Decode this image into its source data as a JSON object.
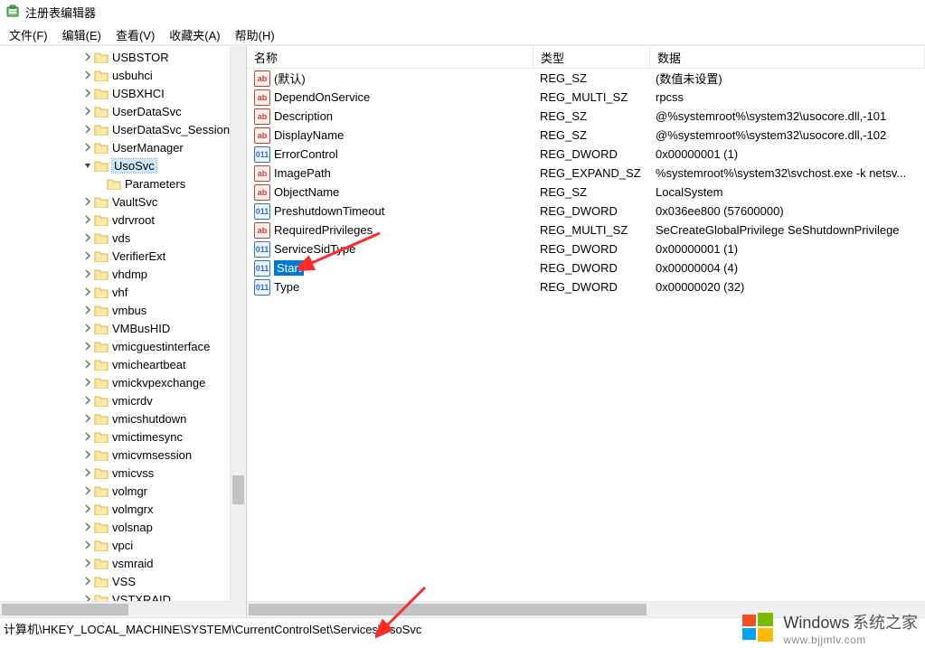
{
  "window": {
    "title": "注册表编辑器"
  },
  "menu": {
    "file": "文件(F)",
    "edit": "编辑(E)",
    "view": "查看(V)",
    "favorites": "收藏夹(A)",
    "help": "帮助(H)"
  },
  "tree": {
    "items": [
      {
        "indent": 5,
        "exp": ">",
        "label": "USBSTOR",
        "sel": false
      },
      {
        "indent": 5,
        "exp": ">",
        "label": "usbuhci",
        "sel": false
      },
      {
        "indent": 5,
        "exp": ">",
        "label": "USBXHCI",
        "sel": false
      },
      {
        "indent": 5,
        "exp": ">",
        "label": "UserDataSvc",
        "sel": false
      },
      {
        "indent": 5,
        "exp": ">",
        "label": "UserDataSvc_Session",
        "sel": false
      },
      {
        "indent": 5,
        "exp": ">",
        "label": "UserManager",
        "sel": false
      },
      {
        "indent": 5,
        "exp": "v",
        "label": "UsoSvc",
        "sel": true
      },
      {
        "indent": 6,
        "exp": "",
        "label": "Parameters",
        "sel": false
      },
      {
        "indent": 5,
        "exp": ">",
        "label": "VaultSvc",
        "sel": false
      },
      {
        "indent": 5,
        "exp": ">",
        "label": "vdrvroot",
        "sel": false
      },
      {
        "indent": 5,
        "exp": ">",
        "label": "vds",
        "sel": false
      },
      {
        "indent": 5,
        "exp": ">",
        "label": "VerifierExt",
        "sel": false
      },
      {
        "indent": 5,
        "exp": ">",
        "label": "vhdmp",
        "sel": false
      },
      {
        "indent": 5,
        "exp": ">",
        "label": "vhf",
        "sel": false
      },
      {
        "indent": 5,
        "exp": ">",
        "label": "vmbus",
        "sel": false
      },
      {
        "indent": 5,
        "exp": ">",
        "label": "VMBusHID",
        "sel": false
      },
      {
        "indent": 5,
        "exp": ">",
        "label": "vmicguestinterface",
        "sel": false
      },
      {
        "indent": 5,
        "exp": ">",
        "label": "vmicheartbeat",
        "sel": false
      },
      {
        "indent": 5,
        "exp": ">",
        "label": "vmickvpexchange",
        "sel": false
      },
      {
        "indent": 5,
        "exp": ">",
        "label": "vmicrdv",
        "sel": false
      },
      {
        "indent": 5,
        "exp": ">",
        "label": "vmicshutdown",
        "sel": false
      },
      {
        "indent": 5,
        "exp": ">",
        "label": "vmictimesync",
        "sel": false
      },
      {
        "indent": 5,
        "exp": ">",
        "label": "vmicvmsession",
        "sel": false
      },
      {
        "indent": 5,
        "exp": ">",
        "label": "vmicvss",
        "sel": false
      },
      {
        "indent": 5,
        "exp": ">",
        "label": "volmgr",
        "sel": false
      },
      {
        "indent": 5,
        "exp": ">",
        "label": "volmgrx",
        "sel": false
      },
      {
        "indent": 5,
        "exp": ">",
        "label": "volsnap",
        "sel": false
      },
      {
        "indent": 5,
        "exp": ">",
        "label": "vpci",
        "sel": false
      },
      {
        "indent": 5,
        "exp": ">",
        "label": "vsmraid",
        "sel": false
      },
      {
        "indent": 5,
        "exp": ">",
        "label": "VSS",
        "sel": false
      },
      {
        "indent": 5,
        "exp": ">",
        "label": "VSTXRAID",
        "sel": false
      }
    ]
  },
  "list": {
    "header": {
      "name": "名称",
      "type": "类型",
      "data": "数据"
    },
    "rows": [
      {
        "icon": "ab",
        "name": "(默认)",
        "type": "REG_SZ",
        "data": "(数值未设置)",
        "sel": false
      },
      {
        "icon": "ab",
        "name": "DependOnService",
        "type": "REG_MULTI_SZ",
        "data": "rpcss",
        "sel": false
      },
      {
        "icon": "ab",
        "name": "Description",
        "type": "REG_SZ",
        "data": "@%systemroot%\\system32\\usocore.dll,-101",
        "sel": false
      },
      {
        "icon": "ab",
        "name": "DisplayName",
        "type": "REG_SZ",
        "data": "@%systemroot%\\system32\\usocore.dll,-102",
        "sel": false
      },
      {
        "icon": "bin",
        "name": "ErrorControl",
        "type": "REG_DWORD",
        "data": "0x00000001 (1)",
        "sel": false
      },
      {
        "icon": "ab",
        "name": "ImagePath",
        "type": "REG_EXPAND_SZ",
        "data": "%systemroot%\\system32\\svchost.exe -k netsv...",
        "sel": false
      },
      {
        "icon": "ab",
        "name": "ObjectName",
        "type": "REG_SZ",
        "data": "LocalSystem",
        "sel": false
      },
      {
        "icon": "bin",
        "name": "PreshutdownTimeout",
        "type": "REG_DWORD",
        "data": "0x036ee800 (57600000)",
        "sel": false
      },
      {
        "icon": "ab",
        "name": "RequiredPrivileges",
        "type": "REG_MULTI_SZ",
        "data": "SeCreateGlobalPrivilege SeShutdownPrivilege",
        "sel": false
      },
      {
        "icon": "bin",
        "name": "ServiceSidType",
        "type": "REG_DWORD",
        "data": "0x00000001 (1)",
        "sel": false
      },
      {
        "icon": "bin",
        "name": "Start",
        "type": "REG_DWORD",
        "data": "0x00000004 (4)",
        "sel": true
      },
      {
        "icon": "bin",
        "name": "Type",
        "type": "REG_DWORD",
        "data": "0x00000020 (32)",
        "sel": false
      }
    ]
  },
  "status": {
    "path": "计算机\\HKEY_LOCAL_MACHINE\\SYSTEM\\CurrentControlSet\\Services\\UsoSvc"
  },
  "watermark": {
    "line1": "Windows",
    "line1b": "系统之家",
    "line2": "www.bjjmlv.com"
  }
}
